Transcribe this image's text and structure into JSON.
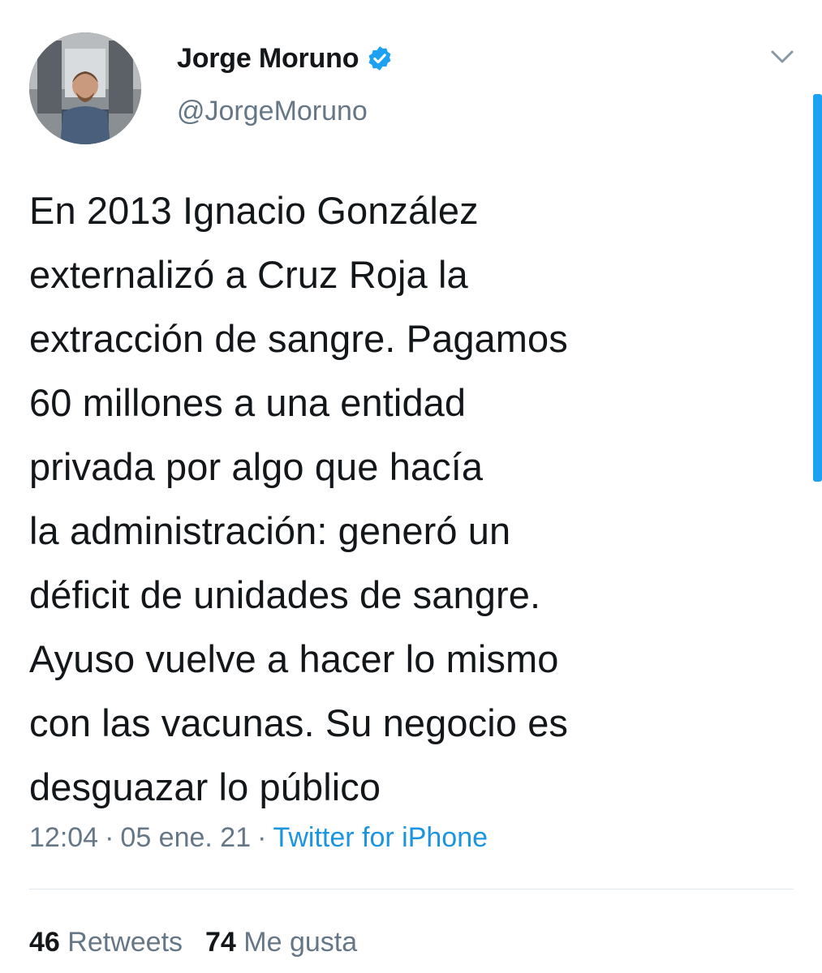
{
  "author": {
    "display_name": "Jorge Moruno",
    "handle": "@JorgeMoruno",
    "verified_icon": "verified-badge-icon",
    "avatar_icon": "avatar-photo"
  },
  "tweet": {
    "lines": [
      "En 2013 Ignacio González",
      "externalizó a Cruz Roja la",
      "extracción de sangre. Pagamos",
      "60 millones a una entidad",
      "privada por algo que hacía",
      "la administración: generó un",
      "déficit de unidades de sangre.",
      "Ayuso vuelve a hacer lo mismo",
      "con las vacunas. Su negocio es",
      "desguazar lo público"
    ],
    "time": "12:04",
    "separator": "·",
    "date": "05 ene. 21",
    "source": "Twitter for iPhone"
  },
  "stats": {
    "retweets_count": "46",
    "retweets_label": "Retweets",
    "likes_count": "74",
    "likes_label": "Me gusta"
  },
  "colors": {
    "text": "#14171a",
    "secondary": "#657786",
    "link": "#1b95e0",
    "verified": "#1da1f2"
  },
  "icons": {
    "menu": "chevron-down-icon"
  }
}
